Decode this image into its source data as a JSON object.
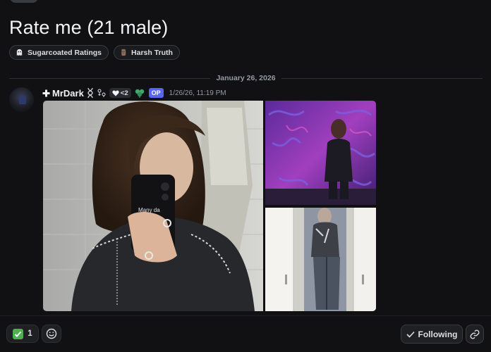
{
  "post": {
    "title": "Rate me (21 male)",
    "tags": [
      {
        "label": "Sugarcoated Ratings",
        "icon": "ghost-icon"
      },
      {
        "label": "Harsh Truth",
        "icon": "moai-icon"
      }
    ]
  },
  "divider": {
    "date": "January 26, 2026"
  },
  "message": {
    "author": {
      "name": "MrDark",
      "prefix_icon": "cross-icon",
      "heart_badge": "<2",
      "op_label": "OP"
    },
    "timestamp": "1/26/26, 11:19 PM",
    "images": [
      {
        "name": "selfie-mirror-photo"
      },
      {
        "name": "graffiti-wall-photo"
      },
      {
        "name": "closet-mirror-photo"
      }
    ]
  },
  "reactions": [
    {
      "emoji": "check-mark-emoji",
      "count": "1"
    }
  ],
  "actions": {
    "following_label": "Following",
    "copy_link": "link-icon"
  },
  "colors": {
    "background": "#111114",
    "op_badge": "#5865f2",
    "check_green": "#4caf50"
  }
}
